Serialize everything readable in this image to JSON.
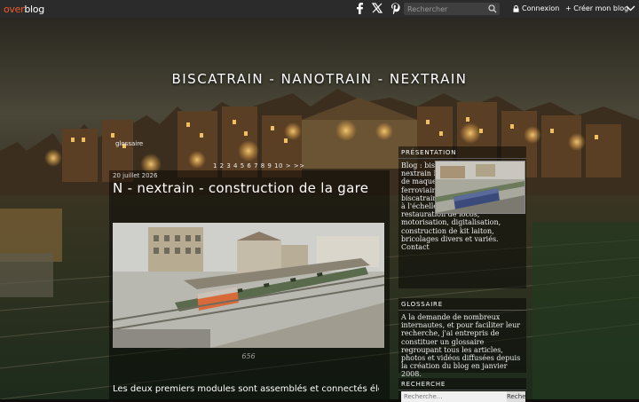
{
  "topbar": {
    "logo_over": "over",
    "logo_blog": "blog",
    "search_placeholder": "Rechercher",
    "login_label": "Connexion",
    "create_label": "+ Créer mon blog",
    "icons": [
      "facebook-icon",
      "x-twitter-icon",
      "pinterest-icon",
      "search-icon",
      "lock-icon",
      "close-icon"
    ]
  },
  "header": {
    "title": "BISCATRAIN - NANOTRAIN - NEXTRAIN",
    "nav_link": "glossaire",
    "pager": "1 2 3 4 5 6 7 8 9 10 > >>"
  },
  "post": {
    "date": "20 juillet 2026",
    "title": "N - nextrain - construction de la gare",
    "caption": "656",
    "text": "Les deux premiers modules sont assemblés et connectés électriquement, différents tests de circulation sur les son"
  },
  "sidebar": {
    "presentation_head": "PRÉSENTATION",
    "presentation_text": "Blog : biscatrain, nanotrain, nextrain Description : réalisation de maquettes et modèles ferroviaires à l'échelle HO - biscatrain - nanotrain et nextrain à l'échelle N et travaux de restauration de locos, motorisation, digitalisation, construction de kit laiton, bricolages divers et variés.",
    "contact_link": "Contact",
    "glossaire_head": "GLOSSAIRE",
    "glossaire_text": "A la demande de nombreux internautes, et pour faciliter leur recherche, j'ai entrepris de constituer un glossaire regroupant tous les articles, photos et vidéos diffusées depuis la création du blog en janvier 2008.",
    "recherche_head": "RECHERCHE",
    "recherche_placeholder": "Recherche...",
    "recherche_button": "Reche"
  },
  "colors": {
    "topbar_bg": "#2b2b2b",
    "logo_accent": "#f15a24"
  }
}
